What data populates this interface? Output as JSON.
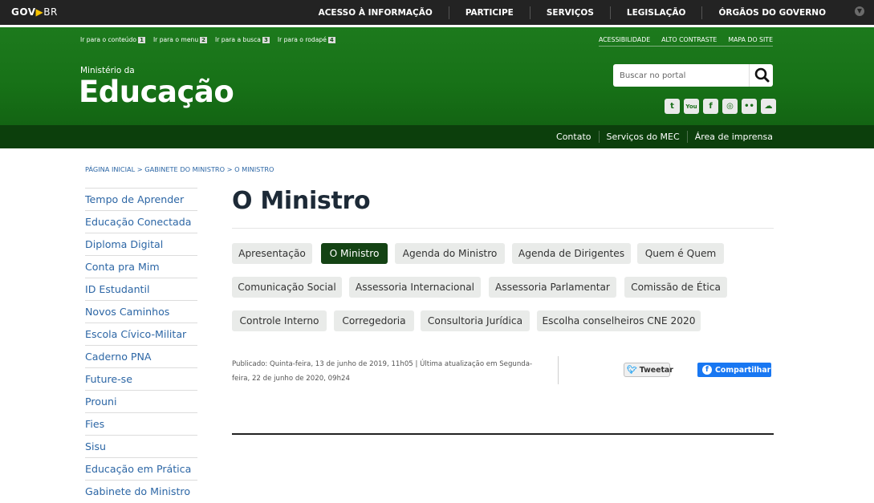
{
  "govbar": {
    "logo_gov": "GOV",
    "logo_br": "BR",
    "items": [
      "ACESSO À INFORMAÇÃO",
      "PARTICIPE",
      "SERVIÇOS",
      "LEGISLAÇÃO",
      "ÓRGÃOS DO GOVERNO"
    ]
  },
  "skiplinks": [
    {
      "label": "Ir para o conteúdo",
      "key": "1"
    },
    {
      "label": "Ir para o menu",
      "key": "2"
    },
    {
      "label": "Ir para a busca",
      "key": "3"
    },
    {
      "label": "Ir para o rodapé",
      "key": "4"
    }
  ],
  "accessibility": [
    "ACESSIBILIDADE",
    "ALTO CONTRASTE",
    "MAPA DO SITE"
  ],
  "brand": {
    "line1": "Ministério da",
    "line2": "Educação"
  },
  "search": {
    "placeholder": "Buscar no portal"
  },
  "social": [
    "twitter-icon",
    "youtube-icon",
    "facebook-icon",
    "instagram-icon",
    "flickr-icon",
    "soundcloud-icon"
  ],
  "subnav": [
    "Contato",
    "Serviços do MEC",
    "Área de imprensa"
  ],
  "breadcrumb": "PÁGINA INICIAL > GABINETE DO MINISTRO > O MINISTRO",
  "sidebar": [
    "Tempo de Aprender",
    "Educação Conectada",
    "Diploma Digital",
    "Conta pra Mim",
    "ID Estudantil",
    "Novos Caminhos",
    "Escola Cívico-Militar",
    "Caderno PNA",
    "Future-se",
    "Prouni",
    "Fies",
    "Sisu",
    "Educação em Prática",
    "Gabinete do Ministro"
  ],
  "page_title": "O Ministro",
  "tabs": [
    "Apresentação",
    "O Ministro",
    "Agenda do Ministro",
    "Agenda de Dirigentes",
    "Quem é Quem",
    "Comunicação Social",
    "Assessoria Internacional",
    "Assessoria Parlamentar",
    "Comissão de Ética",
    "Controle Interno",
    "Corregedoria",
    "Consultoria Jurídica",
    "Escolha conselheiros CNE 2020"
  ],
  "active_tab": "O Ministro",
  "published": "Publicado: Quinta-feira, 13 de junho de 2019, 11h05 | Última atualização em Segunda-feira, 22 de junho de 2020, 09h24",
  "tweet_label": "Tweetar",
  "share_label": "Compartilhar",
  "colors": {
    "green": "#177117",
    "dark_green": "#0c3f0c",
    "link": "#2c66a5",
    "active_tab": "#144314"
  }
}
